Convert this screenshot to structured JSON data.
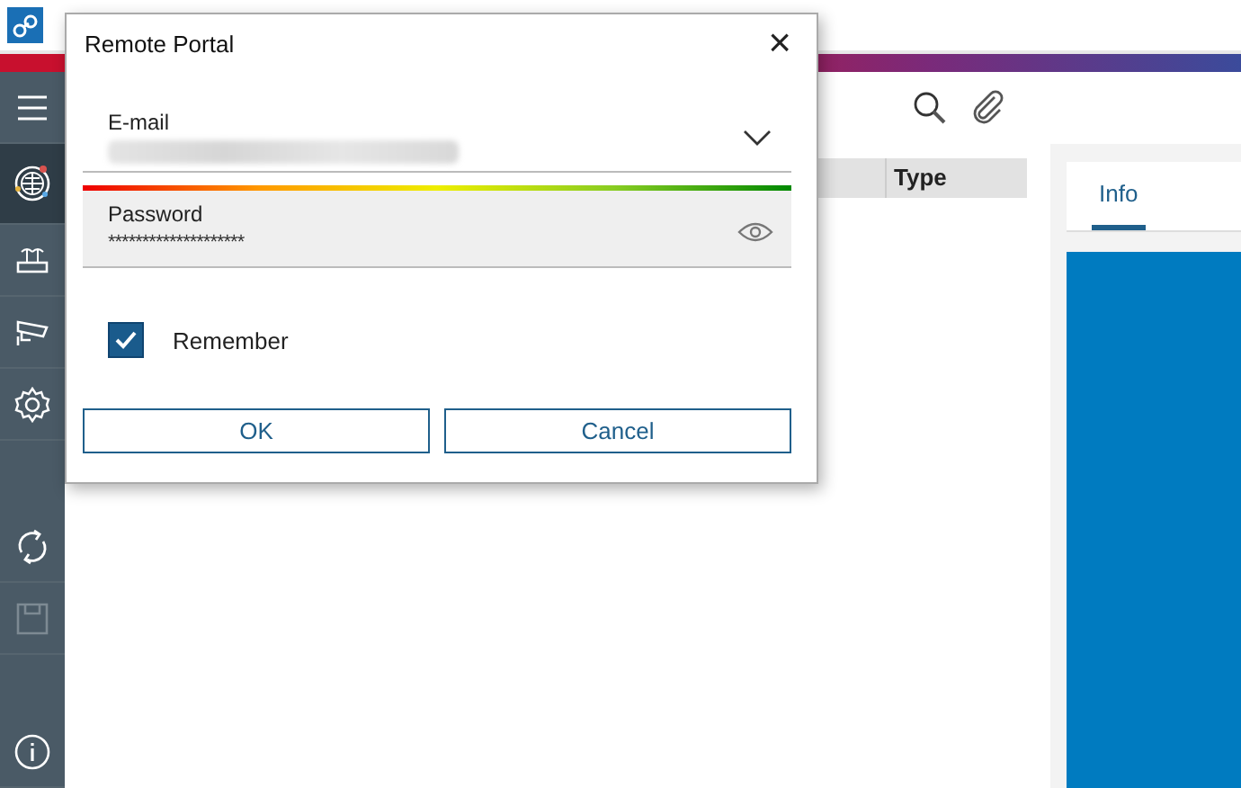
{
  "sidebar": {
    "items": [
      {
        "kind": "menu",
        "selected": false,
        "disabled": false
      },
      {
        "kind": "globe",
        "selected": true,
        "disabled": false
      },
      {
        "kind": "router",
        "selected": false,
        "disabled": false
      },
      {
        "kind": "camera",
        "selected": false,
        "disabled": false
      },
      {
        "kind": "gear",
        "selected": false,
        "disabled": false
      },
      {
        "kind": "sync",
        "selected": false,
        "disabled": false
      },
      {
        "kind": "save",
        "selected": false,
        "disabled": true
      },
      {
        "kind": "info",
        "selected": false,
        "disabled": false
      }
    ]
  },
  "table": {
    "columns": [
      "Type"
    ]
  },
  "details": {
    "tabs": [
      {
        "label": "Info",
        "selected": true
      }
    ]
  },
  "dialog": {
    "title": "Remote Portal",
    "close": "×",
    "email": {
      "label": "E-mail"
    },
    "password_strength": {
      "level": 1
    },
    "password": {
      "label": "Password",
      "value": "********************"
    },
    "remember": {
      "label": "Remember",
      "checked": true
    },
    "buttons": [
      "OK",
      "Cancel"
    ]
  }
}
